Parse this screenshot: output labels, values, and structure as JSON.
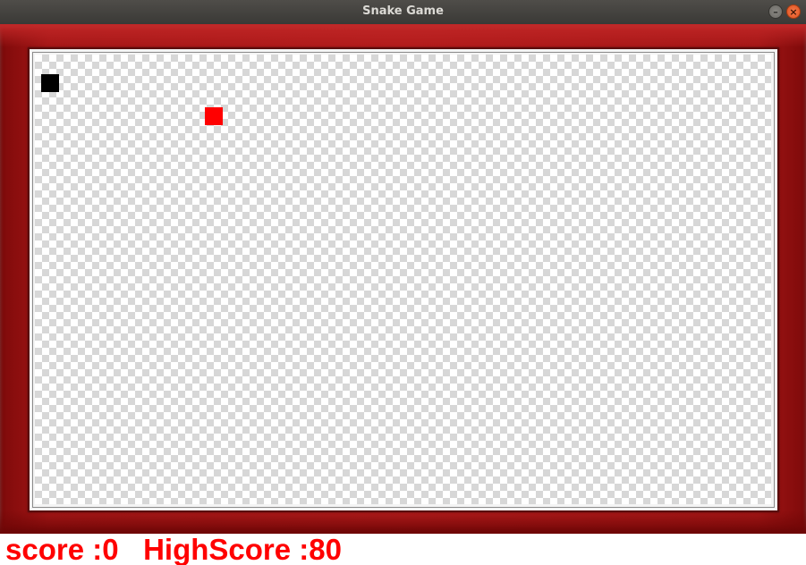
{
  "window": {
    "title": "Snake Game",
    "minimize_glyph": "–",
    "close_glyph": "×"
  },
  "game": {
    "snake": [
      {
        "col": 0,
        "row": 0
      }
    ],
    "food": {
      "col": 9,
      "row": 2
    },
    "snake_color": "#000000",
    "food_color": "#ff0000",
    "frame_color": "#b21b1b"
  },
  "scoreboard": {
    "score_label": "score :",
    "score_value": "0",
    "highscore_label": "HighScore :",
    "highscore_value": "80",
    "text_color": "#ff0000"
  }
}
